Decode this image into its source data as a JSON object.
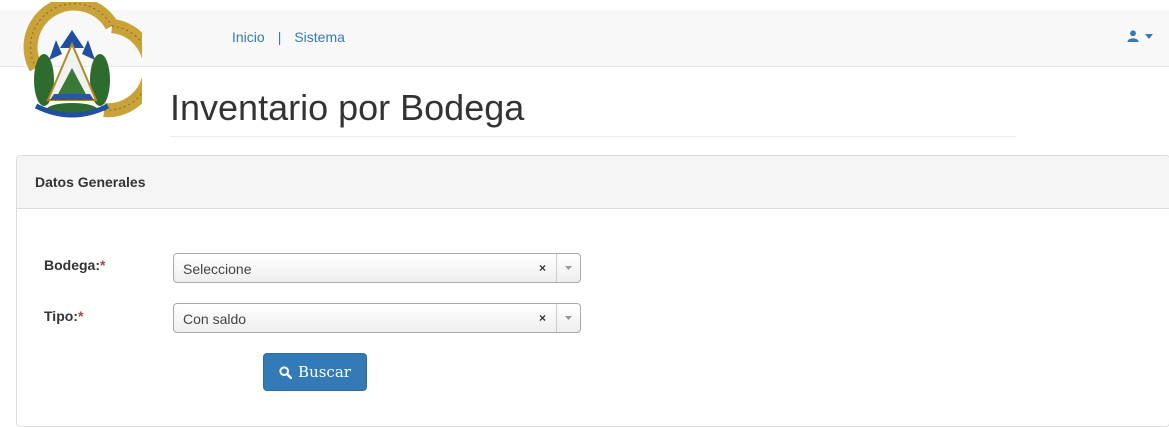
{
  "nav": {
    "links": [
      "Inicio",
      "Sistema"
    ],
    "separator": "|"
  },
  "page": {
    "title": "Inventario por Bodega"
  },
  "panel": {
    "heading": "Datos Generales"
  },
  "form": {
    "bodega": {
      "label": "Bodega:",
      "required_mark": "*",
      "value": "Seleccione",
      "clear": "×"
    },
    "tipo": {
      "label": "Tipo:",
      "required_mark": "*",
      "value": "Con saldo",
      "clear": "×"
    },
    "search_button": "Buscar"
  },
  "colors": {
    "accent": "#337ab7",
    "required": "#a94442",
    "navbar_bg": "#f8f8f8",
    "panel_heading_bg": "#f5f5f5"
  },
  "icons": {
    "user": "user-icon",
    "caret": "caret-down-icon",
    "search": "search-icon",
    "logo": "coat-of-arms-el-salvador"
  }
}
